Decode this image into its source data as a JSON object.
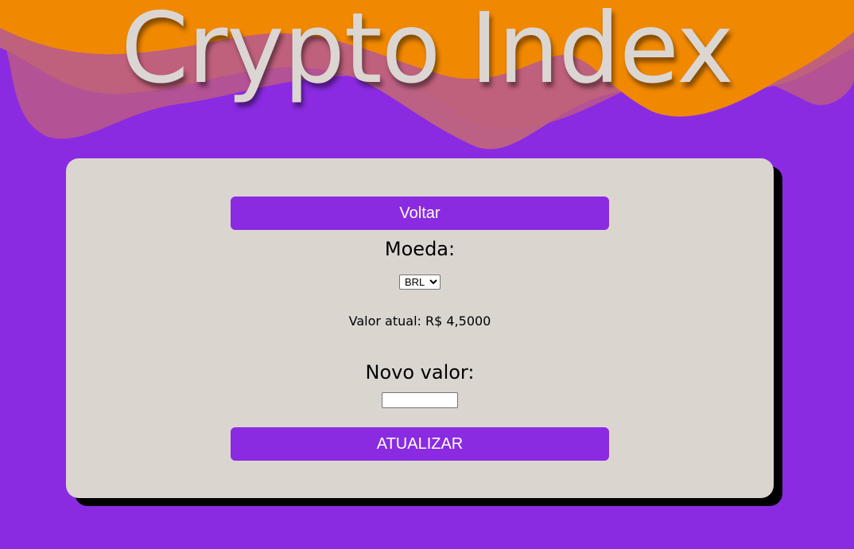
{
  "header": {
    "title": "Crypto Index"
  },
  "form": {
    "back_label": "Voltar",
    "currency_label": "Moeda:",
    "currency_selected": "BRL",
    "current_value_text": "Valor atual: R$ 4,5000",
    "new_value_label": "Novo valor:",
    "new_value_input": "",
    "update_label": "ATUALIZAR"
  },
  "colors": {
    "background": "#8a2be2",
    "accent": "#8a2be2",
    "wave_orange": "#f08800",
    "card": "#dbd5d0"
  }
}
